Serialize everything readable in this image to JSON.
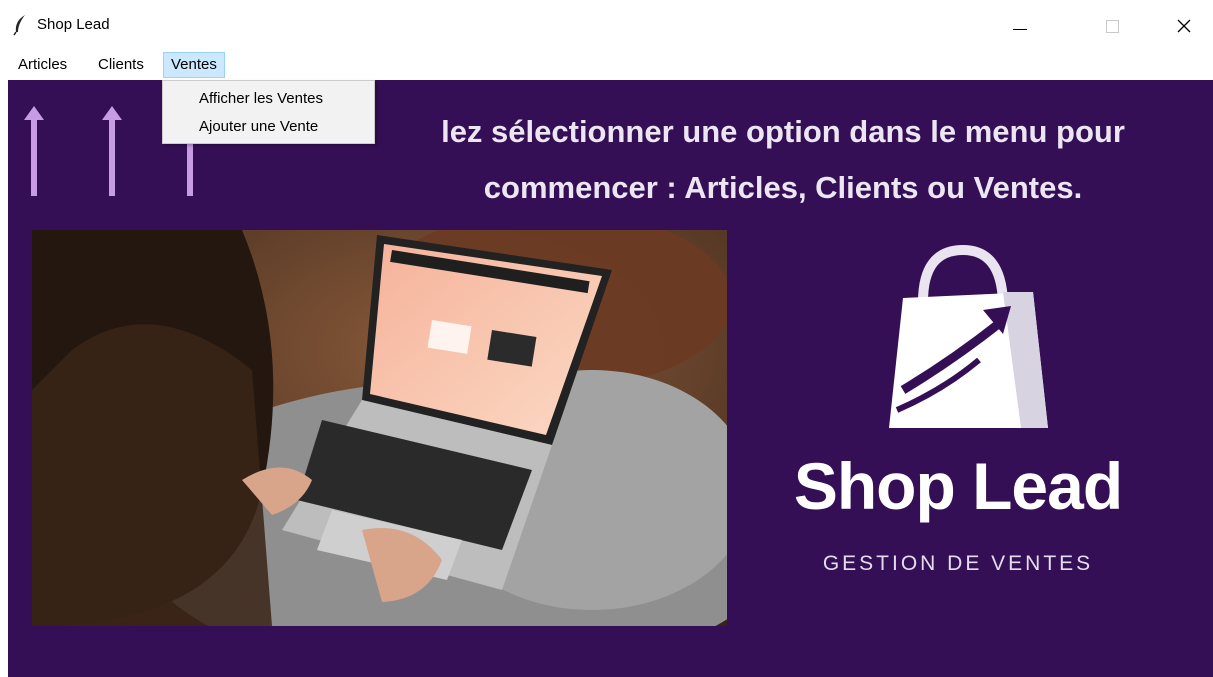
{
  "window": {
    "title": "Shop Lead",
    "icon": "feather-icon",
    "controls": [
      "minimize-icon",
      "maximize-icon",
      "close-icon"
    ]
  },
  "menubar": {
    "items": [
      {
        "label": "Articles"
      },
      {
        "label": "Clients"
      },
      {
        "label": "Ventes",
        "open": true
      }
    ]
  },
  "dropdown": {
    "items": [
      {
        "label": "Afficher les Ventes"
      },
      {
        "label": "Ajouter une Vente"
      }
    ]
  },
  "main": {
    "headline_line1": "lez sélectionner une option dans le menu pour",
    "headline_line2": "commencer : Articles, Clients ou Ventes.",
    "background_color": "#350f56",
    "arrow_color": "#c79be6"
  },
  "brand": {
    "name": "Shop Lead",
    "tagline": "GESTION DE VENTES",
    "logo_icon": "shopping-bag-icon"
  }
}
